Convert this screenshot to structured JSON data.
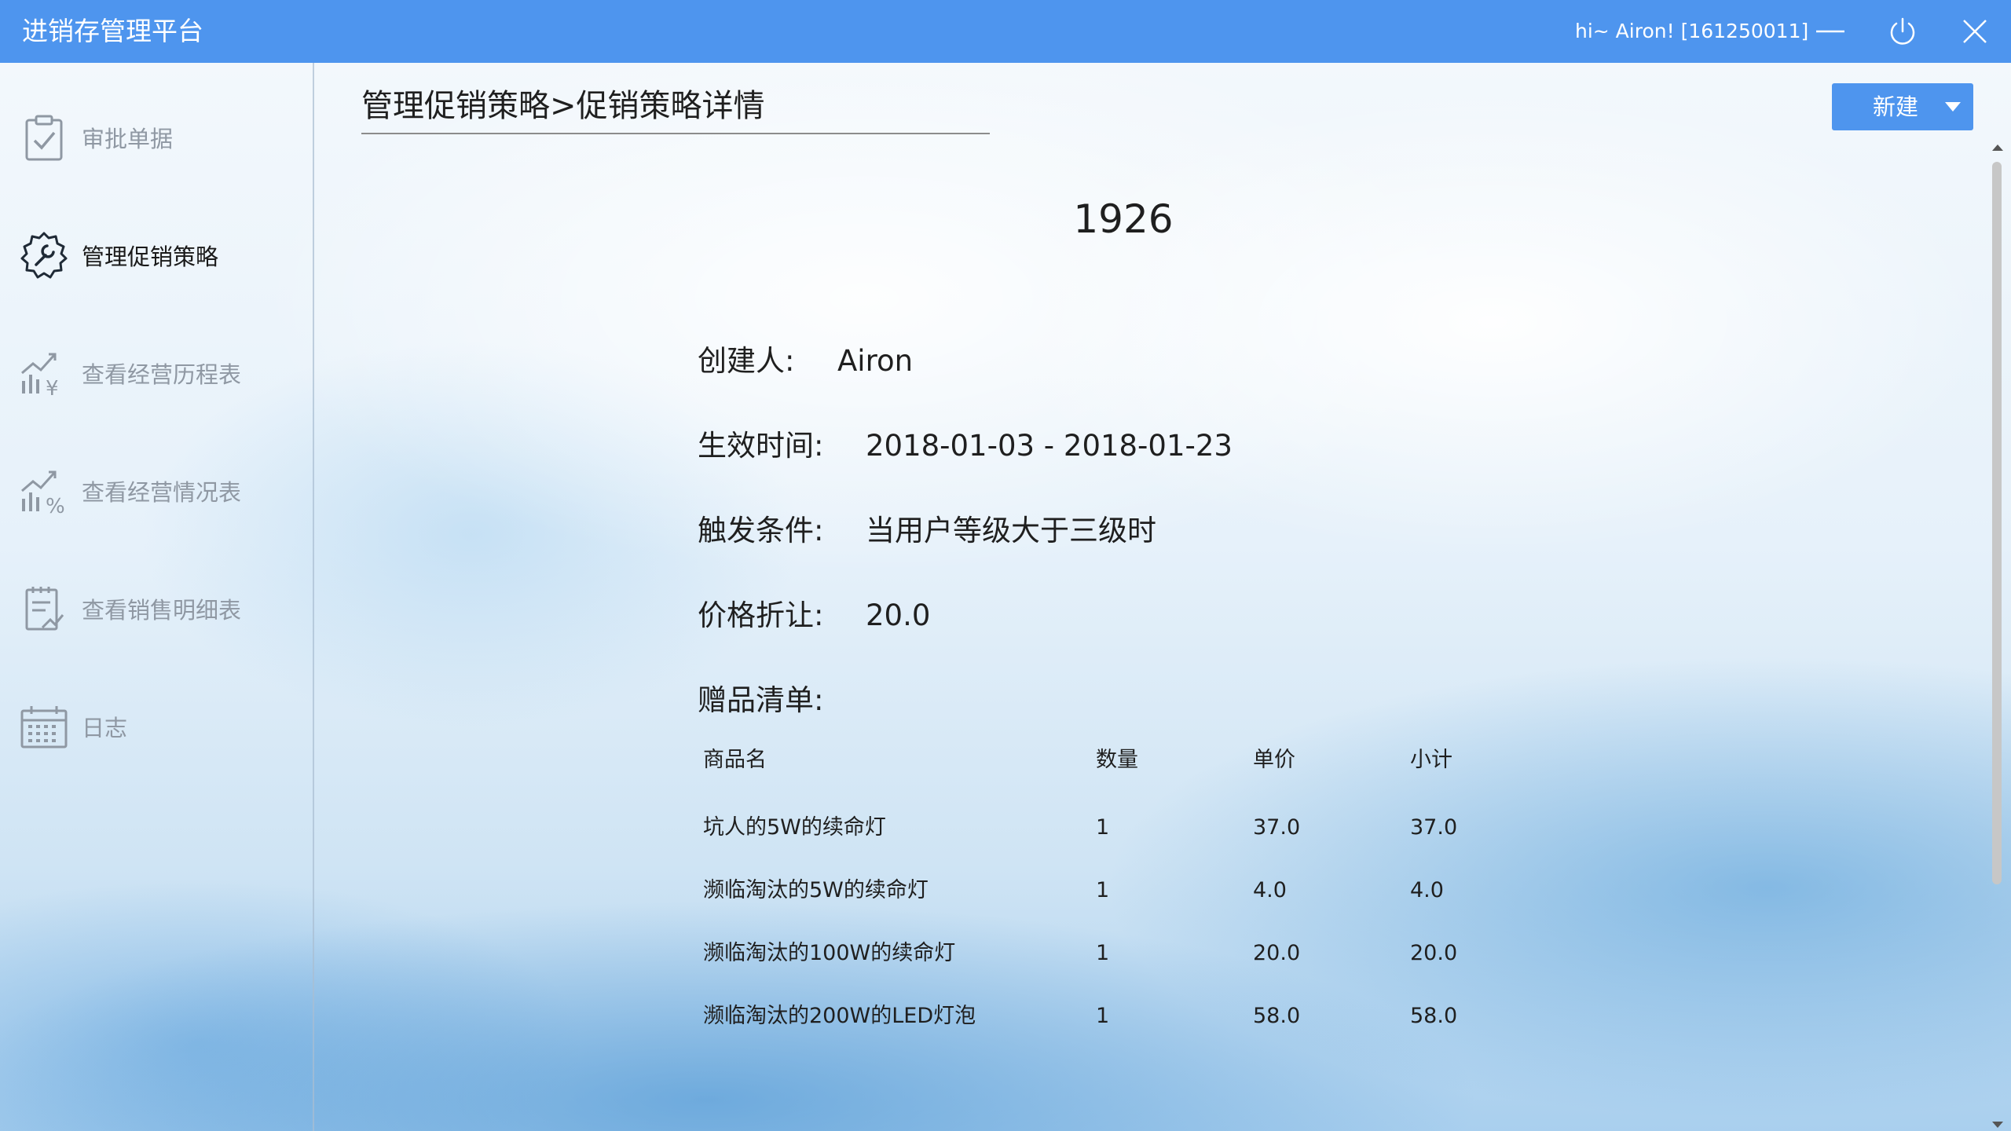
{
  "titlebar": {
    "app_title": "进销存管理平台",
    "user_info": "hi~ Airon! [161250011]",
    "minimize_icon": "minimize-icon",
    "power_icon": "power-icon",
    "close_icon": "close-icon"
  },
  "sidebar": {
    "items": [
      {
        "label": "审批单据",
        "icon": "clipboard-check-icon",
        "active": false
      },
      {
        "label": "管理促销策略",
        "icon": "wrench-gear-icon",
        "active": true
      },
      {
        "label": "查看经营历程表",
        "icon": "chart-yen-icon",
        "active": false
      },
      {
        "label": "查看经营情况表",
        "icon": "chart-percent-icon",
        "active": false
      },
      {
        "label": "查看销售明细表",
        "icon": "document-chart-icon",
        "active": false
      },
      {
        "label": "日志",
        "icon": "calendar-icon",
        "active": false
      }
    ]
  },
  "main": {
    "breadcrumb": "管理促销策略>促销策略详情",
    "new_button": "新建",
    "detail_title": "1926",
    "fields": {
      "creator_label": "创建人:",
      "creator_value": "Airon",
      "effective_label": "生效时间:",
      "effective_value": "2018-01-03 - 2018-01-23",
      "trigger_label": "触发条件:",
      "trigger_value": "当用户等级大于三级时",
      "discount_label": "价格折让:",
      "discount_value": "20.0"
    },
    "gift_list_title": "赠品清单:",
    "gift_table": {
      "headers": [
        "商品名",
        "数量",
        "单价",
        "小计"
      ],
      "rows": [
        [
          "坑人的5W的续命灯",
          "1",
          "37.0",
          "37.0"
        ],
        [
          "濒临淘汰的5W的续命灯",
          "1",
          "4.0",
          "4.0"
        ],
        [
          "濒临淘汰的100W的续命灯",
          "1",
          "20.0",
          "20.0"
        ],
        [
          "濒临淘汰的200W的LED灯泡",
          "1",
          "58.0",
          "58.0"
        ]
      ]
    }
  },
  "colors": {
    "accent": "#4e95ee",
    "inactive_text": "#8f98a3"
  }
}
